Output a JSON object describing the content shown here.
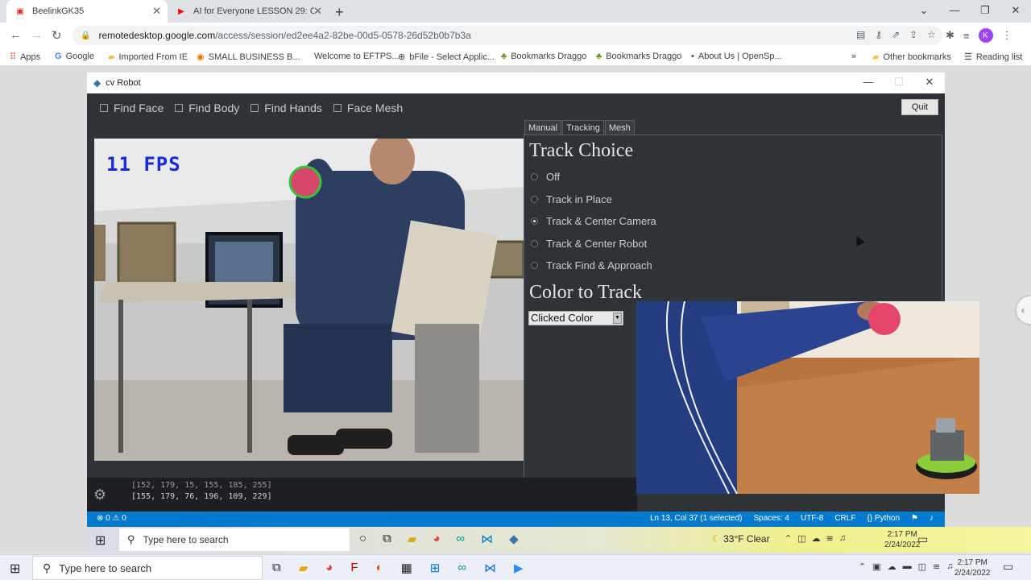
{
  "browser": {
    "tabs": [
      {
        "title": "BeelinkGK35",
        "icon": "remote-desktop-icon"
      },
      {
        "title": "AI for Everyone LESSON 29: Cont",
        "icon": "youtube-icon"
      }
    ],
    "address": {
      "domain": "remotedesktop.google.com",
      "path": "/access/session/ed2ee4a2-82be-00d5-0578-26d52b0b7b3a"
    },
    "avatar_letter": "K",
    "bookmarks": [
      "Apps",
      "Google",
      "Imported From IE",
      "SMALL BUSINESS B...",
      "Welcome to EFTPS...",
      "bFile - Select Applic...",
      "Bookmarks Draggo",
      "Bookmarks Draggo",
      "About Us | OpenSp...",
      "»",
      "Other bookmarks",
      "Reading list"
    ]
  },
  "app": {
    "title": "cv Robot",
    "checkboxes": [
      "Find Face",
      "Find Body",
      "Find Hands",
      "Face Mesh"
    ],
    "quit_label": "Quit",
    "fps_label": "11 FPS",
    "tabs": [
      "Manual",
      "Tracking",
      "Mesh"
    ],
    "selected_tab": "Tracking",
    "track_choice_title": "Track Choice",
    "track_options": [
      "Off",
      "Track in Place",
      "Track & Center Camera",
      "Track & Center Robot",
      "Track Find & Approach"
    ],
    "selected_track": "Track & Center Camera",
    "color_title": "Color to Track",
    "color_select_value": "Clicked Color",
    "console_lines": [
      "[152, 179, 15, 155, 185, 255]",
      "[155, 179, 76, 196, 109, 229]"
    ]
  },
  "statusbar": {
    "left": "⊗ 0 ⚠ 0",
    "items": [
      "Ln 13, Col 37 (1 selected)",
      "Spaces: 4",
      "UTF-8",
      "CRLF",
      "{} Python"
    ]
  },
  "remote_taskbar": {
    "search_placeholder": "Type here to search",
    "weather": "33°F  Clear",
    "time": "2:17 PM",
    "date": "2/24/2022"
  },
  "host_taskbar": {
    "search_placeholder": "Type here to search",
    "time": "2:17 PM",
    "date": "2/24/2022"
  },
  "colors": {
    "accent": "#007acc",
    "fps_text": "#1a2bd6",
    "ball": "#d9466b"
  }
}
